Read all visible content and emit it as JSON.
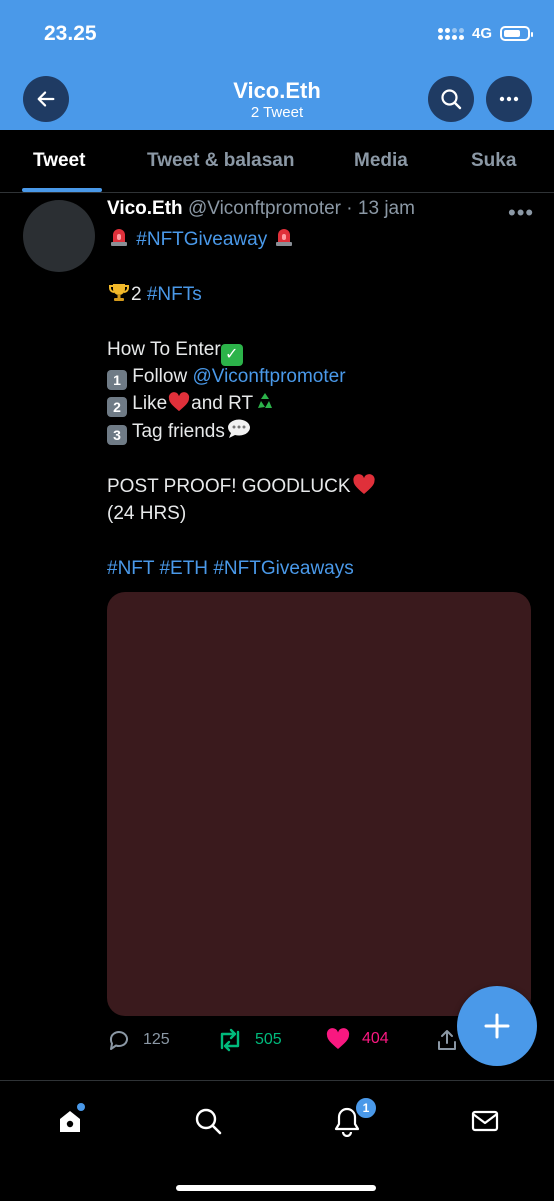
{
  "status_bar": {
    "time": "23.25",
    "network": "4G"
  },
  "header": {
    "title": "Vico.Eth",
    "subtitle": "2 Tweet",
    "bg_color": "#4a99e9"
  },
  "tabs": [
    {
      "label": "Tweet",
      "active": true
    },
    {
      "label": "Tweet & balasan",
      "active": false
    },
    {
      "label": "Media",
      "active": false
    },
    {
      "label": "Suka",
      "active": false
    }
  ],
  "tweet": {
    "name": "Vico.Eth",
    "handle": "@Viconftpromoter",
    "time": "· 13 jam",
    "hashtag_giveaway": "#NFTGiveaway",
    "prize_count": "2",
    "hashtag_nfts": "#NFTs",
    "how_to_enter": "How To Enter",
    "step1_key": "1",
    "step1_text": "Follow",
    "step1_mention": "@Viconftpromoter",
    "step2_key": "2",
    "step2_text": "Like",
    "step2_text_b": "and RT",
    "step3_key": "3",
    "step3_text": "Tag friends",
    "proof": "POST PROOF! GOODLUCK",
    "duration": "(24 HRS)",
    "tag_nft": "#NFT",
    "tag_eth": "#ETH",
    "tag_giveaways": "#NFTGiveaways",
    "media_color": "#3a1a1d"
  },
  "actions": {
    "replies": "125",
    "retweets": "505",
    "likes": "404"
  },
  "colors": {
    "retweet": "#00ba7c",
    "like": "#f91880",
    "accent": "#4a99e9",
    "muted": "#8b98a5"
  },
  "bottom_nav": {
    "notification_count": "1"
  },
  "icons": [
    "back-arrow-icon",
    "search-icon",
    "more-icon",
    "reply-icon",
    "retweet-icon",
    "heart-icon",
    "share-icon",
    "compose-plus-icon",
    "home-icon",
    "notifications-bell-icon",
    "messages-envelope-icon"
  ]
}
